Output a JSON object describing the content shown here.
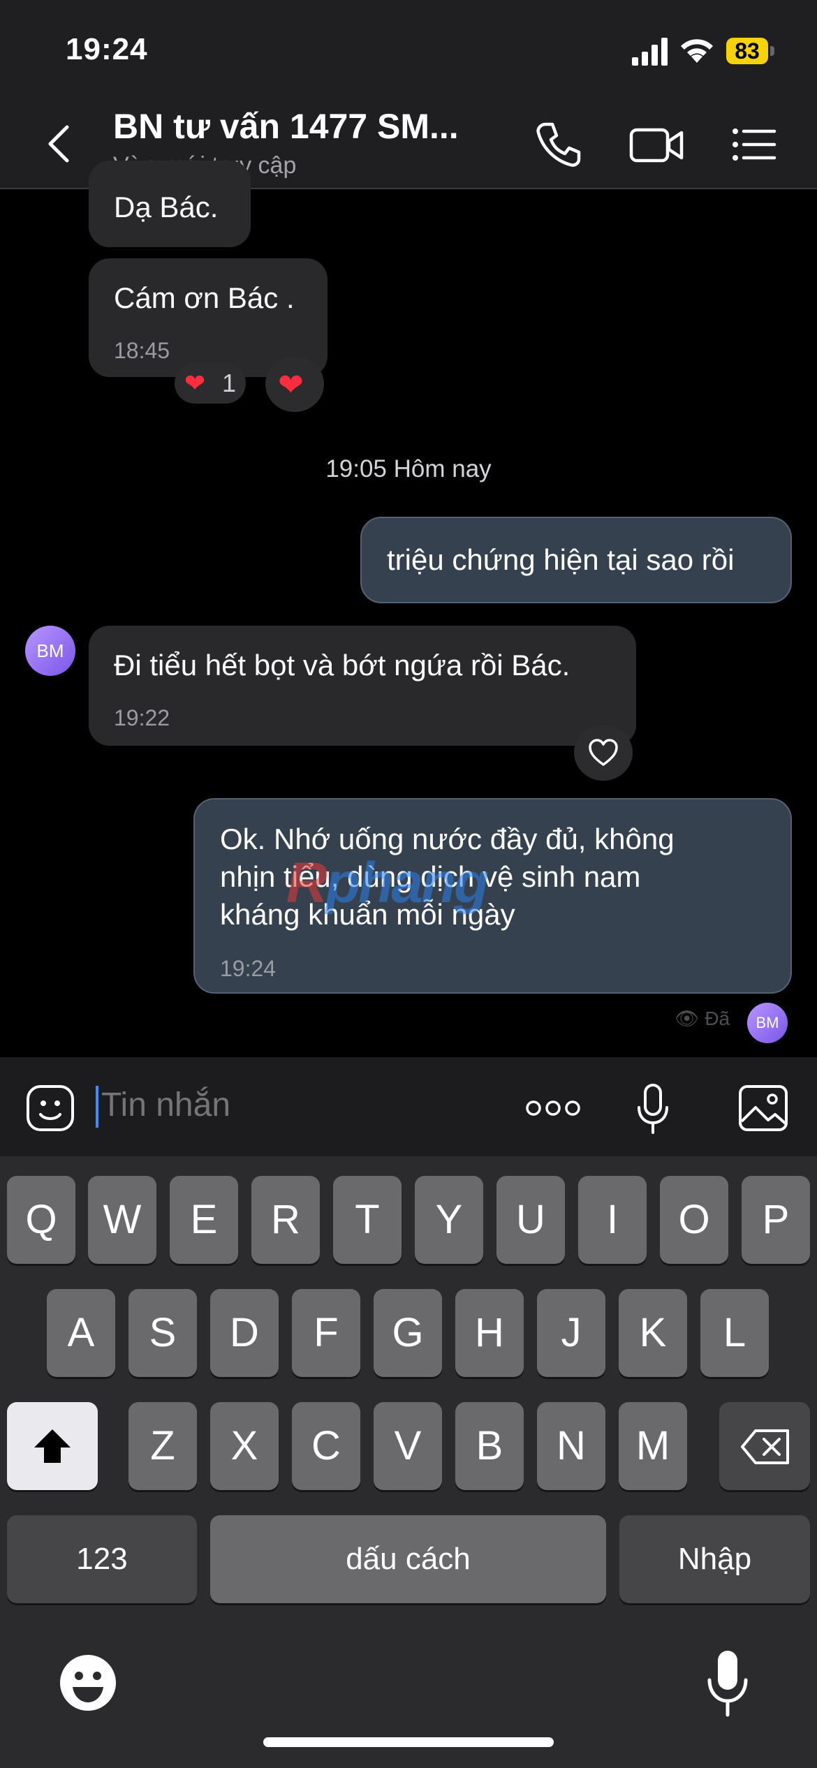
{
  "status": {
    "time": "19:24",
    "battery": "83"
  },
  "header": {
    "title": "BN tư vấn 1477 SM...",
    "subtitle": "Vừa mới truy cập"
  },
  "avatar_initials": "BM",
  "messages": [
    {
      "text": "Dạ Bác."
    },
    {
      "text": "Cám ơn Bác .",
      "time": "18:45",
      "reaction_count": "1"
    },
    {
      "text": "triệu chứng hiện tại sao rồi"
    },
    {
      "text": "Đi tiểu hết bọt và bớt ngứa rồi Bác.",
      "time": "19:22"
    },
    {
      "lines": [
        "Ok. Nhớ uống nước đầy đủ, không",
        "nhịn tiểu, dùng dịch vệ sinh nam",
        "kháng khuẩn mỗi ngày"
      ],
      "time": "19:24"
    }
  ],
  "date_separator": "19:05 Hôm nay",
  "seen_label": "Đã",
  "composer": {
    "placeholder": "Tin nhắn"
  },
  "watermark": {
    "a": "R",
    "b": "phang"
  },
  "keyboard": {
    "row1": [
      "Q",
      "W",
      "E",
      "R",
      "T",
      "Y",
      "U",
      "I",
      "O",
      "P"
    ],
    "row2": [
      "A",
      "S",
      "D",
      "F",
      "G",
      "H",
      "J",
      "K",
      "L"
    ],
    "row3": [
      "Z",
      "X",
      "C",
      "V",
      "B",
      "N",
      "M"
    ],
    "numbers": "123",
    "space": "dấu cách",
    "enter": "Nhập"
  }
}
